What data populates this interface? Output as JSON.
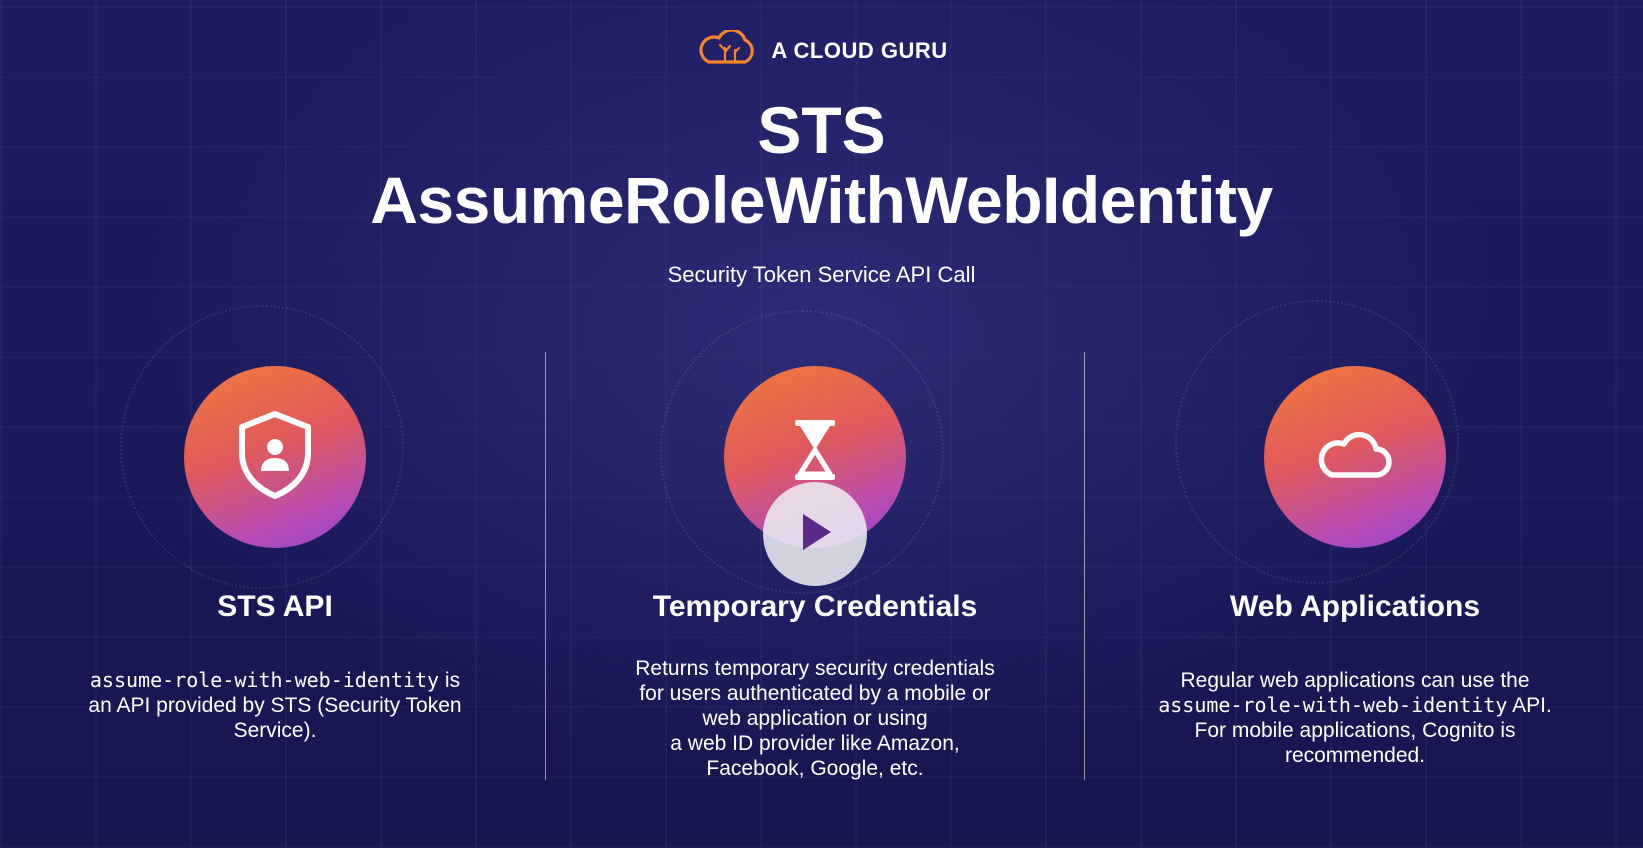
{
  "brand": {
    "name": "A CLOUD GURU",
    "logo_icon": "cloud-logo-icon",
    "accent": "#f5832a"
  },
  "header": {
    "title_line1": "STS",
    "title_line2": "AssumeRoleWithWebIdentity",
    "subtitle": "Security Token Service API Call"
  },
  "columns": [
    {
      "icon": "shield-user-icon",
      "title": "STS API",
      "desc_code": "assume-role-with-web-identity",
      "desc_after_code": " is",
      "desc_line2": "an API provided by STS (Security Token",
      "desc_line3": "Service)."
    },
    {
      "icon": "hourglass-icon",
      "title": "Temporary Credentials",
      "desc_lines": [
        "Returns temporary security credentials",
        "for users authenticated by a mobile or",
        "web application or using",
        "a web ID provider like Amazon,",
        "Facebook, Google, etc."
      ]
    },
    {
      "icon": "cloud-icon",
      "title": "Web Applications",
      "desc_line1": "Regular web applications can use the",
      "desc_code": "assume-role-with-web-identity",
      "desc_after_code": " API.",
      "desc_line3": "For mobile applications, Cognito is",
      "desc_line4": "recommended."
    }
  ],
  "video": {
    "play_icon": "play-icon"
  },
  "colors": {
    "background": "#1b1a5a",
    "circle_start": "#f07a3a",
    "circle_end": "#8e46d0"
  }
}
